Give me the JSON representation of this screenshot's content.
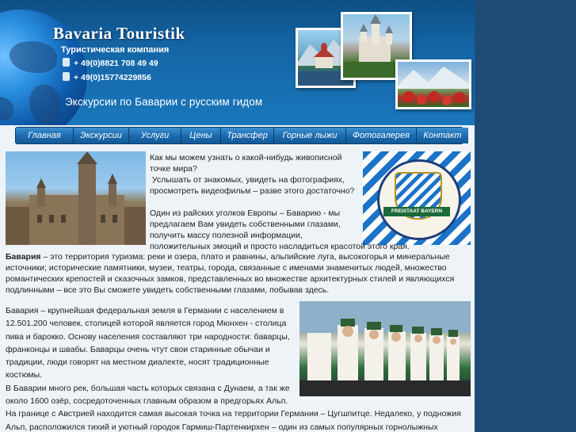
{
  "header": {
    "logo": "Bavaria Touristik",
    "company": "Туристическая компания",
    "phone1": "+ 49(0)8821 708 49 49",
    "phone2": "+ 49(0)15774229856",
    "slogan": "Экскурсии по Баварии с русским гидом"
  },
  "menu": [
    {
      "label": "Главная"
    },
    {
      "label": "Экскурсии"
    },
    {
      "label": "Услуги"
    },
    {
      "label": "Цены"
    },
    {
      "label": "Трансфер"
    },
    {
      "label": "Горные лыжи"
    },
    {
      "label": "Фотогалерея"
    },
    {
      "label": "Контакт"
    }
  ],
  "crest": {
    "band_text": "FREISTAAT BAYERN"
  },
  "content": {
    "intro_lines": [
      "Как мы можем узнать о какой-нибудь живописной",
      "точке мира?",
      " Услышать от знакомых, увидеть на фотографиях,",
      "просмотреть видеофильм – разве этого достаточно?",
      "",
      "Один из райских уголков Европы – Баварию - мы",
      "предлагаем Вам увидеть собственными глазами,",
      "получить массу полезной информации,",
      "положительных эмоций и просто насладиться красотой этого края."
    ],
    "para1_bold": "Бавария",
    "para1_lines": [
      " – это территория туризма: реки и озера, плато и равнины, альпийские луга, высокогорья и минеральные",
      "источники; исторические памятники, музеи, театры, города, связанные с именами знаменитых людей, множество",
      "романтических крепостей и сказочных замков, представленных во множестве архитектурных стилей и являющихся",
      "подлинными – все это Вы сможете увидеть собственными глазами, побывав здесь."
    ],
    "para2_lines": [
      "Бавария – крупнейшая федеральная земля в Германии с населением в",
      "12.501.200 человек, столицей которой является город Мюнхен - столица",
      "пива и барокко. Основу населения составляют три народности: баварцы,",
      "франконцы и швабы. Баварцы очень чтут свои старинные обычаи и",
      "традиции, люди говорят на местном диалекте, носят традиционные",
      "костюмы.",
      "В Баварии много рек, большая часть которых связана с Дунаем, а так же",
      "около 1600 озёр, сосредоточенных главным образом в предгорьях Альп.",
      "На границе с Австрией находится самая высокая точка на территории Германии – Цугшпитце. Недалеко, у подножия",
      "Альп, расположился тихий и уютный городок Гармиш-Партенкирхен – один из самых популярных горнолыжных"
    ]
  }
}
